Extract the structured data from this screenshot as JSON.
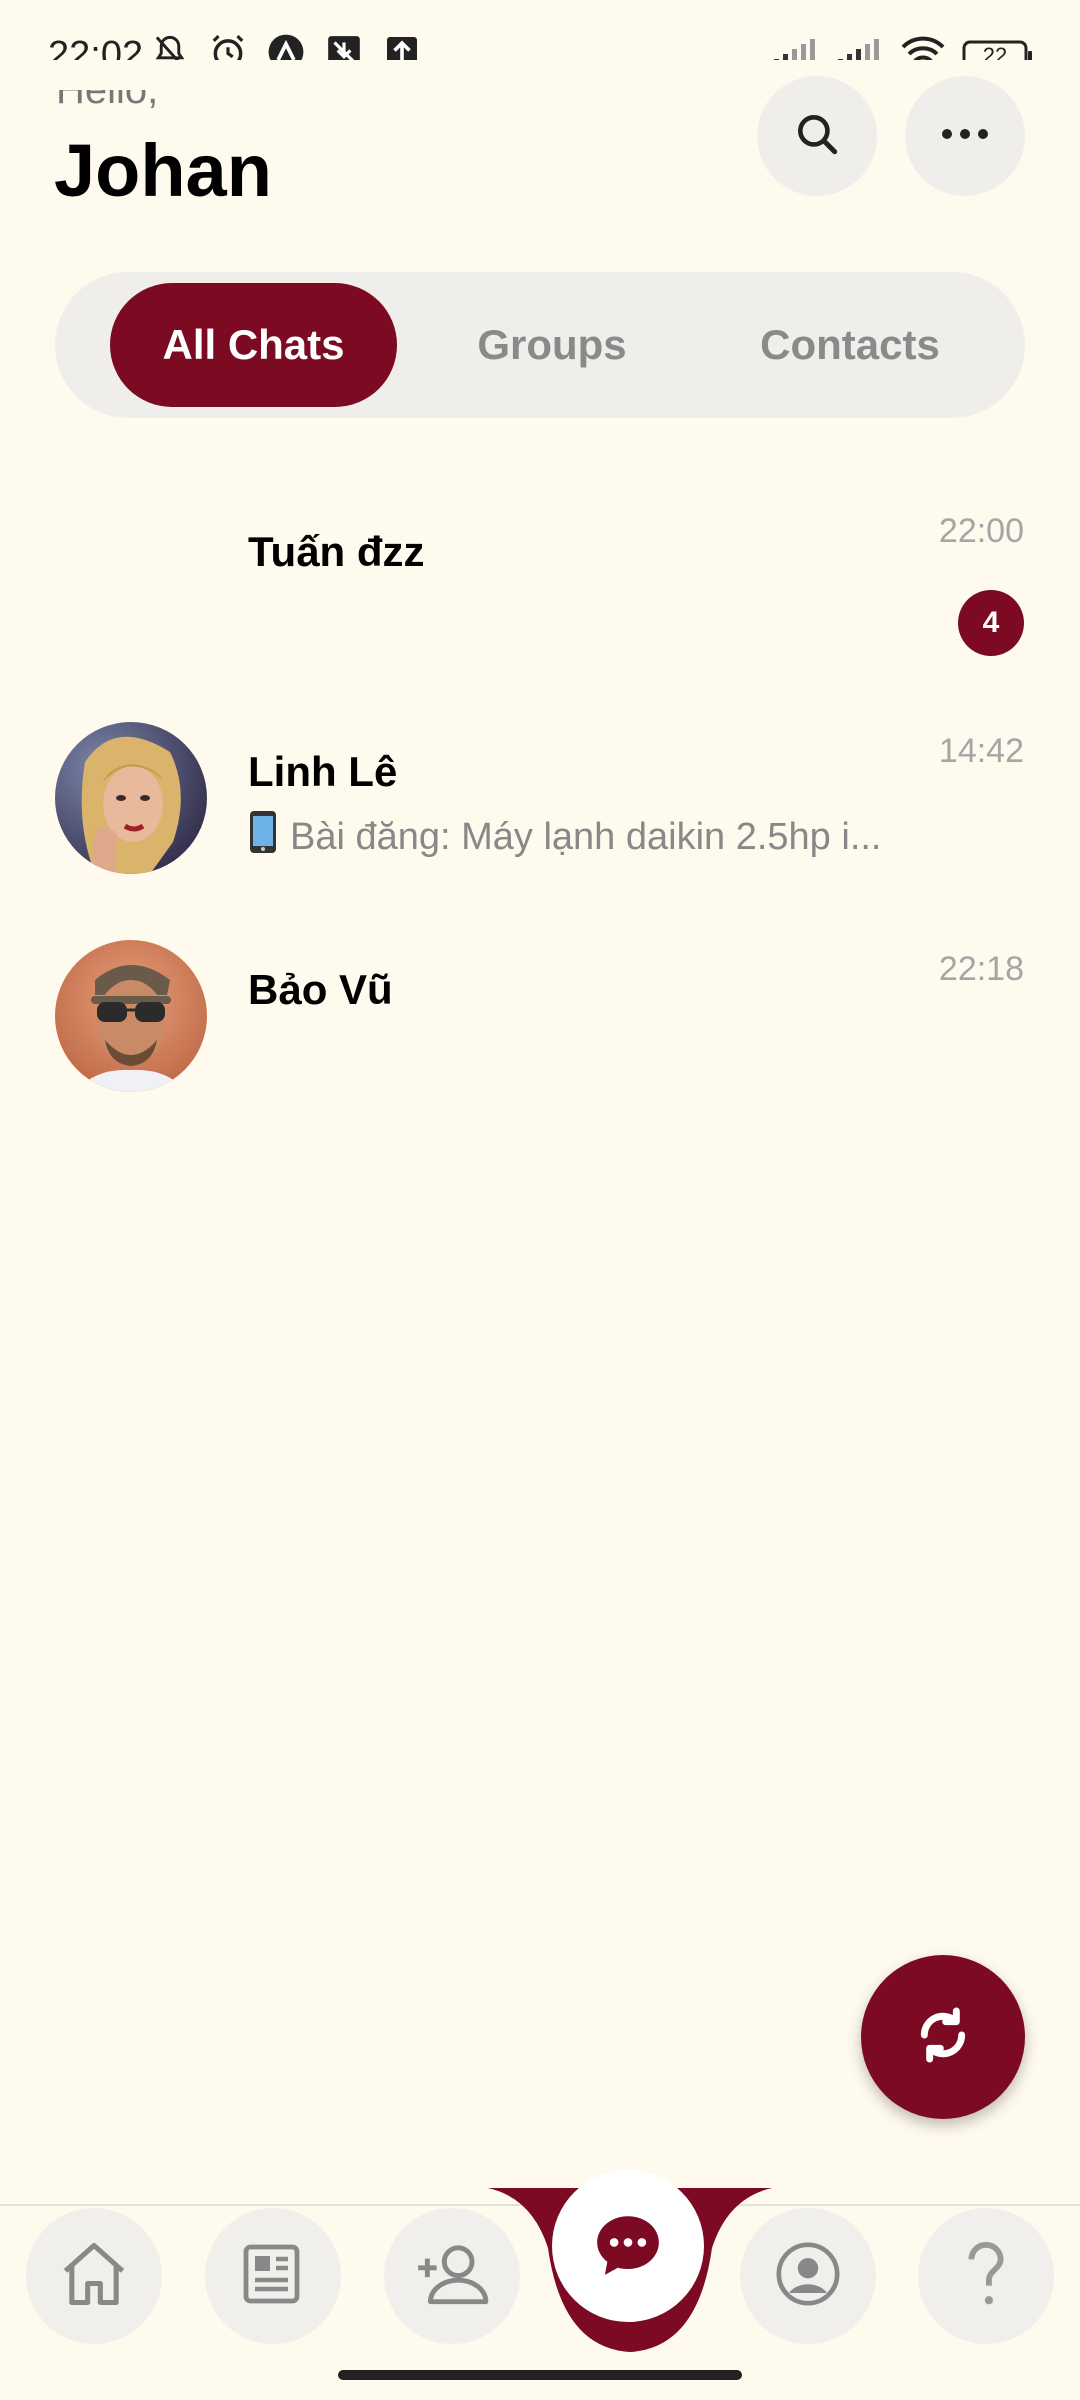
{
  "status_bar": {
    "time": "22:02",
    "battery": "22"
  },
  "header": {
    "greeting": "Hello,",
    "user_name": "Johan",
    "search_icon": "search-icon",
    "more_icon": "more-horizontal-icon"
  },
  "tabs": [
    {
      "label": "All Chats",
      "active": true
    },
    {
      "label": "Groups",
      "active": false
    },
    {
      "label": "Contacts",
      "active": false
    }
  ],
  "chats": [
    {
      "name": "Tuấn đzz",
      "time": "22:00",
      "preview": "",
      "unread": "4",
      "avatar": "none"
    },
    {
      "name": "Linh Lê",
      "time": "14:42",
      "preview": "Bài đăng: Máy lạnh daikin 2.5hp i...",
      "preview_icon": "phone-icon",
      "unread": "",
      "avatar": "photo"
    },
    {
      "name": "Bảo Vũ",
      "time": "22:18",
      "preview": "",
      "unread": "",
      "avatar": "photo"
    }
  ],
  "fab": {
    "icon": "refresh-icon"
  },
  "bottom_nav": [
    {
      "icon": "home-icon"
    },
    {
      "icon": "newspaper-icon"
    },
    {
      "icon": "add-contact-icon"
    },
    {
      "icon": "chat-bubble-icon",
      "active": true
    },
    {
      "icon": "profile-icon"
    },
    {
      "icon": "help-icon"
    }
  ],
  "colors": {
    "background": "#FFFAEE",
    "accent": "#7C0A23",
    "pill_bg": "#EFEEEB",
    "muted_text": "#8A8A8A"
  }
}
